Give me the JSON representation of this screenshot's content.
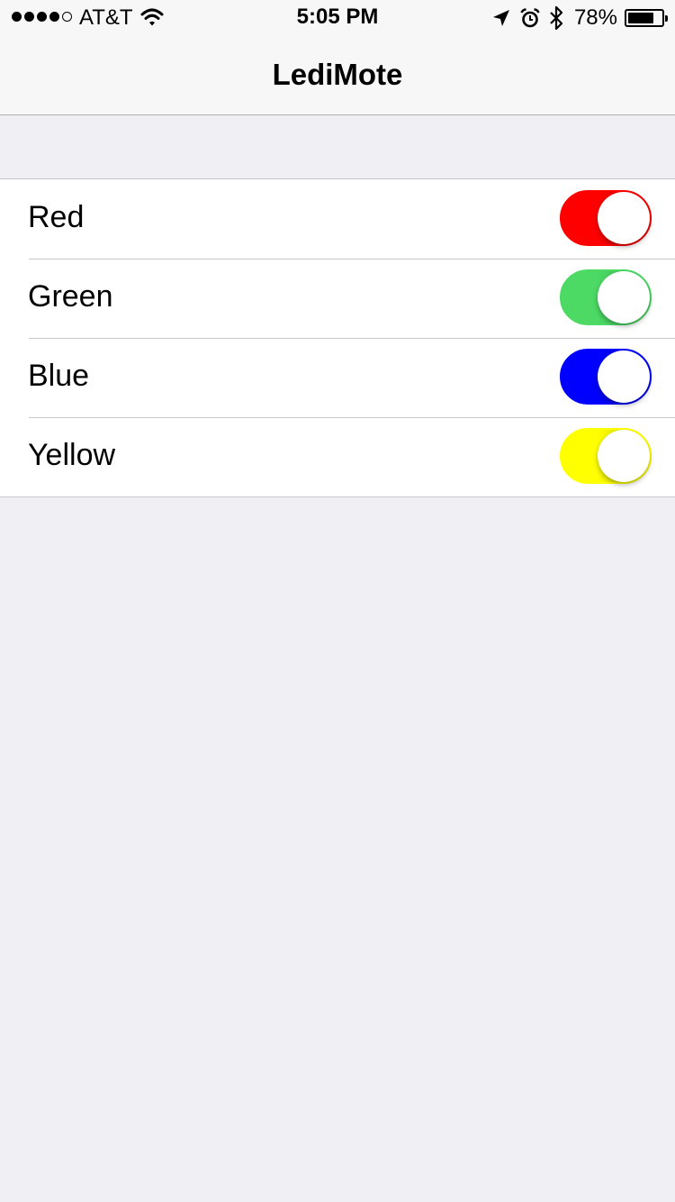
{
  "status_bar": {
    "carrier": "AT&T",
    "time": "5:05 PM",
    "battery_percent": "78%",
    "battery_level": 0.78,
    "signal_filled": 4,
    "signal_total": 5,
    "icons": [
      "wifi-icon",
      "location-arrow-icon",
      "alarm-clock-icon",
      "bluetooth-icon",
      "battery-icon"
    ]
  },
  "nav": {
    "title": "LediMote"
  },
  "switches": [
    {
      "label": "Red",
      "on": true,
      "color": "#ff0000",
      "edge": "#cc0000"
    },
    {
      "label": "Green",
      "on": true,
      "color": "#4cd964",
      "edge": "#3cb454"
    },
    {
      "label": "Blue",
      "on": true,
      "color": "#0000ff",
      "edge": "#0000cc"
    },
    {
      "label": "Yellow",
      "on": true,
      "color": "#ffff00",
      "edge": "#cccc00"
    }
  ]
}
